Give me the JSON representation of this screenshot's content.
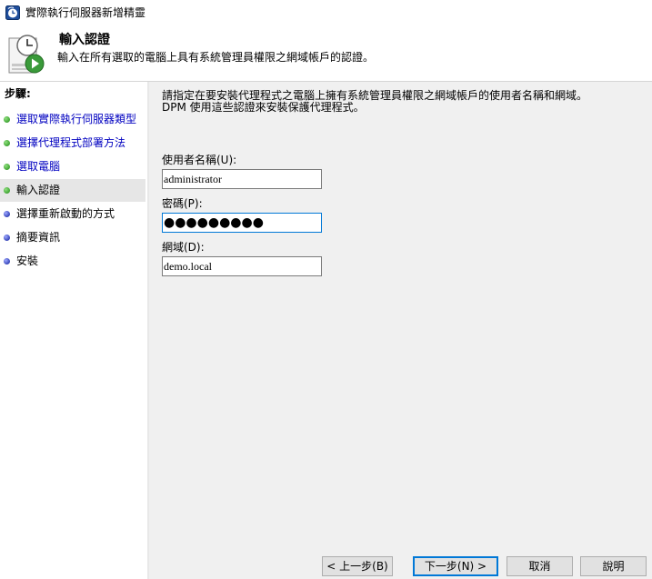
{
  "window": {
    "title": "實際執行伺服器新增精靈"
  },
  "header": {
    "title": "輸入認證",
    "subtitle": "輸入在所有選取的電腦上具有系統管理員權限之網域帳戶的認證。"
  },
  "sidebar": {
    "heading": "步驟:",
    "steps": [
      {
        "label": "選取實際執行伺服器類型",
        "status": "done"
      },
      {
        "label": "選擇代理程式部署方法",
        "status": "done"
      },
      {
        "label": "選取電腦",
        "status": "done"
      },
      {
        "label": "輸入認證",
        "status": "current"
      },
      {
        "label": "選擇重新啟動的方式",
        "status": "pending"
      },
      {
        "label": "摘要資訊",
        "status": "pending"
      },
      {
        "label": "安裝",
        "status": "pending"
      }
    ]
  },
  "main": {
    "instructions_line1": "請指定在要安裝代理程式之電腦上擁有系統管理員權限之網域帳戶的使用者名稱和網域。",
    "instructions_line2": "DPM 使用這些認證來安裝保護代理程式。",
    "username": {
      "label": "使用者名稱(U):",
      "value": "administrator"
    },
    "password": {
      "label": "密碼(P):",
      "value": "●●●●●●●●●"
    },
    "domain": {
      "label": "網域(D):",
      "value": "demo.local"
    }
  },
  "buttons": {
    "back": "< 上一步(B)",
    "next": "下一步(N) >",
    "cancel": "取消",
    "help": "說明"
  },
  "colors": {
    "step_done": "#3fa332",
    "step_pending": "#3544b8",
    "link": "#0000c0",
    "focus": "#0078d7"
  }
}
